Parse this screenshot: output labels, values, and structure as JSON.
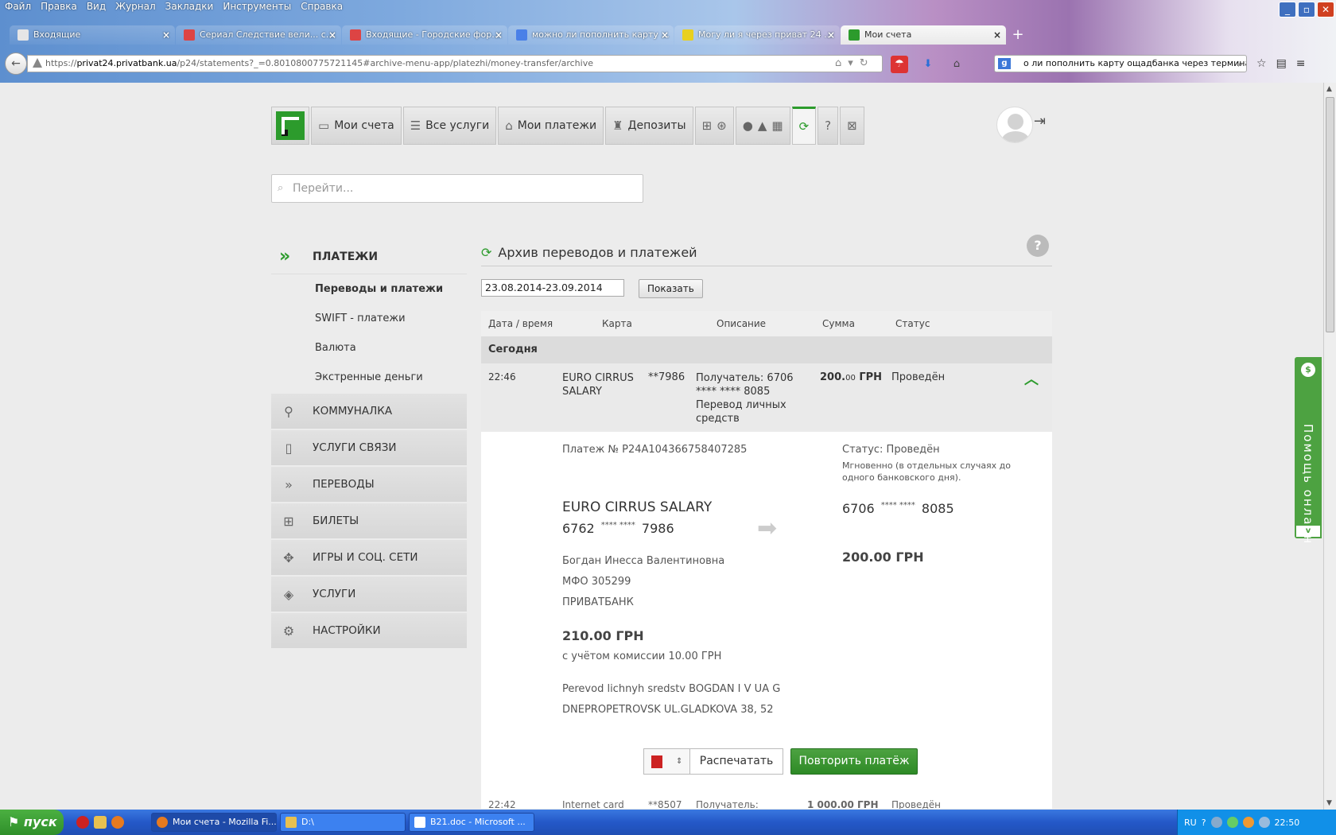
{
  "browser": {
    "menu": [
      "Файл",
      "Правка",
      "Вид",
      "Журнал",
      "Закладки",
      "Инструменты",
      "Справка"
    ],
    "tabs": [
      {
        "label": "Входящие",
        "icon": "mail-icon",
        "color": "#e6e6e6"
      },
      {
        "label": "Сериал Следствие вели... с...",
        "icon": "feather-icon",
        "color": "#d44"
      },
      {
        "label": "Входящие - Городские фор...",
        "icon": "forum-icon",
        "color": "#d44"
      },
      {
        "label": "можно ли пополнить карту ...",
        "icon": "google-icon",
        "color": "#4a80e8"
      },
      {
        "label": "Могу ли я через приват 24 ...",
        "icon": "smiley-icon",
        "color": "#e8d020"
      },
      {
        "label": "Мои счета",
        "icon": "privat-icon",
        "color": "#2c9b2c"
      }
    ],
    "url_scheme": "https://",
    "url_host": "privat24.privatbank.ua",
    "url_path": "/p24/statements?_=0.8010800775721145#archive-menu-app/platezhi/money-transfer/archive",
    "search_text": "о ли пополнить карту ощадбанка через терминал"
  },
  "nav": {
    "my_accounts": "Мои счета",
    "all_services": "Все услуги",
    "my_payments": "Мои платежи",
    "deposits": "Депозиты"
  },
  "search": {
    "placeholder": "Перейти..."
  },
  "sidebar": {
    "section": "ПЛАТЕЖИ",
    "sub": [
      "Переводы и платежи",
      "SWIFT - платежи",
      "Валюта",
      "Экстренные деньги"
    ],
    "items": [
      {
        "label": "КОММУНАЛКА",
        "icon": "faucet-icon",
        "glyph": "⚲"
      },
      {
        "label": "УСЛУГИ СВЯЗИ",
        "icon": "phone-icon",
        "glyph": "▯"
      },
      {
        "label": "ПЕРЕВОДЫ",
        "icon": "double-chevron-icon",
        "glyph": "»"
      },
      {
        "label": "БИЛЕТЫ",
        "icon": "train-plane-icon",
        "glyph": "⊞"
      },
      {
        "label": "ИГРЫ И СОЦ. СЕТИ",
        "icon": "gamepad-icon",
        "glyph": "✥"
      },
      {
        "label": "УСЛУГИ",
        "icon": "layers-icon",
        "glyph": "◈"
      },
      {
        "label": "НАСТРОЙКИ",
        "icon": "gear-icon",
        "glyph": "⚙"
      }
    ]
  },
  "archive": {
    "title": "Архив переводов и платежей",
    "date_range": "23.08.2014-23.09.2014",
    "show_button": "Показать",
    "columns": [
      "Дата / время",
      "Карта",
      "Описание",
      "Сумма",
      "Статус"
    ],
    "group": "Сегодня",
    "row": {
      "time": "22:46",
      "card_name_1": "EURO CIRRUS",
      "card_name_2": "SALARY",
      "card_masked": "**7986",
      "desc_1": "Получатель: 6706",
      "desc_2": "**** **** 8085",
      "desc_3": "Перевод личных",
      "desc_4": "средств",
      "amount_main": "200.",
      "amount_cents": "00",
      "amount_currency": "ГРН",
      "status": "Проведён"
    },
    "detail": {
      "payment_no": "Платеж № P24A104366758407285",
      "status_line": "Статус: Проведён",
      "status_note_1": "Мгновенно (в отдельных случаях до",
      "status_note_2": "одного банковского дня).",
      "from_card_name": "EURO CIRRUS SALARY",
      "from_card_start": "6762",
      "from_card_mid": "****  ****",
      "from_card_end": "7986",
      "to_card_start": "6706",
      "to_card_mid": "****  ****",
      "to_card_end": "8085",
      "to_amount": "200.00 ГРН",
      "owner": "Богдан Инесса Валентиновна",
      "mfo": "МФО 305299",
      "bank": "ПРИВАТБАНК",
      "total": "210.00 ГРН",
      "commission": "с учётом комиссии 10.00 ГРН",
      "purpose_1": "Perevod lichnyh sredstv BOGDAN I V UA G",
      "purpose_2": "DNEPROPETROVSK UL.GLADKOVA 38, 52",
      "print": "Распечатать",
      "repeat": "Повторить платёж"
    },
    "next_row": {
      "time": "22:42",
      "card": "Internet card",
      "masked": "**8507",
      "desc": "Получатель:",
      "amount": "1 000.00 ГРН",
      "status": "Проведён"
    }
  },
  "online_help": "Помощь онлайн",
  "taskbar": {
    "start": "пуск",
    "tasks": [
      "Мои счета - Mozilla Fi...",
      "D:\\",
      "B21.doc - Microsoft ..."
    ],
    "lang": "RU",
    "clock": "22:50"
  },
  "colors": {
    "brand_green": "#2c9b2c",
    "button_green": "#3b9632",
    "taskbar_blue": "#2458c8"
  }
}
